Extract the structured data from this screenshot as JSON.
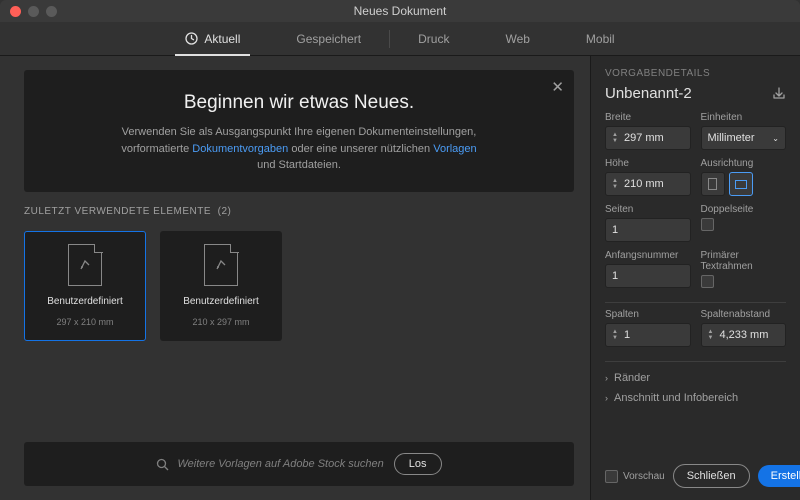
{
  "window": {
    "title": "Neues Dokument"
  },
  "tabs": {
    "recent": "Aktuell",
    "saved": "Gespeichert",
    "print": "Druck",
    "web": "Web",
    "mobile": "Mobil"
  },
  "hero": {
    "headline": "Beginnen wir etwas Neues.",
    "line1a": "Verwenden Sie als Ausgangspunkt Ihre eigenen Dokumenteinstellungen,",
    "line2a": "vorformatierte ",
    "link1": "Dokumentvorgaben",
    "line2b": " oder eine unserer nützlichen ",
    "link2": "Vorlagen",
    "line3": "und Startdateien."
  },
  "recent": {
    "label": "ZULETZT VERWENDETE ELEMENTE",
    "count": "(2)",
    "items": [
      {
        "title": "Benutzerdefiniert",
        "sub": "297 x 210 mm"
      },
      {
        "title": "Benutzerdefiniert",
        "sub": "210 x 297 mm"
      }
    ]
  },
  "search": {
    "placeholder": "Weitere Vorlagen auf Adobe Stock suchen",
    "go": "Los"
  },
  "details": {
    "section": "VORGABENDETAILS",
    "name": "Unbenannt-2",
    "width_label": "Breite",
    "width": "297 mm",
    "units_label": "Einheiten",
    "units": "Millimeter",
    "height_label": "Höhe",
    "height": "210 mm",
    "orientation_label": "Ausrichtung",
    "pages_label": "Seiten",
    "pages": "1",
    "facing_label": "Doppelseite",
    "startnum_label": "Anfangsnummer",
    "startnum": "1",
    "primaryframe_label": "Primärer Textrahmen",
    "columns_label": "Spalten",
    "columns": "1",
    "gutter_label": "Spaltenabstand",
    "gutter": "4,233 mm",
    "margins": "Ränder",
    "bleed": "Anschnitt und Infobereich"
  },
  "footer": {
    "preview": "Vorschau",
    "close": "Schließen",
    "create": "Erstellen"
  }
}
